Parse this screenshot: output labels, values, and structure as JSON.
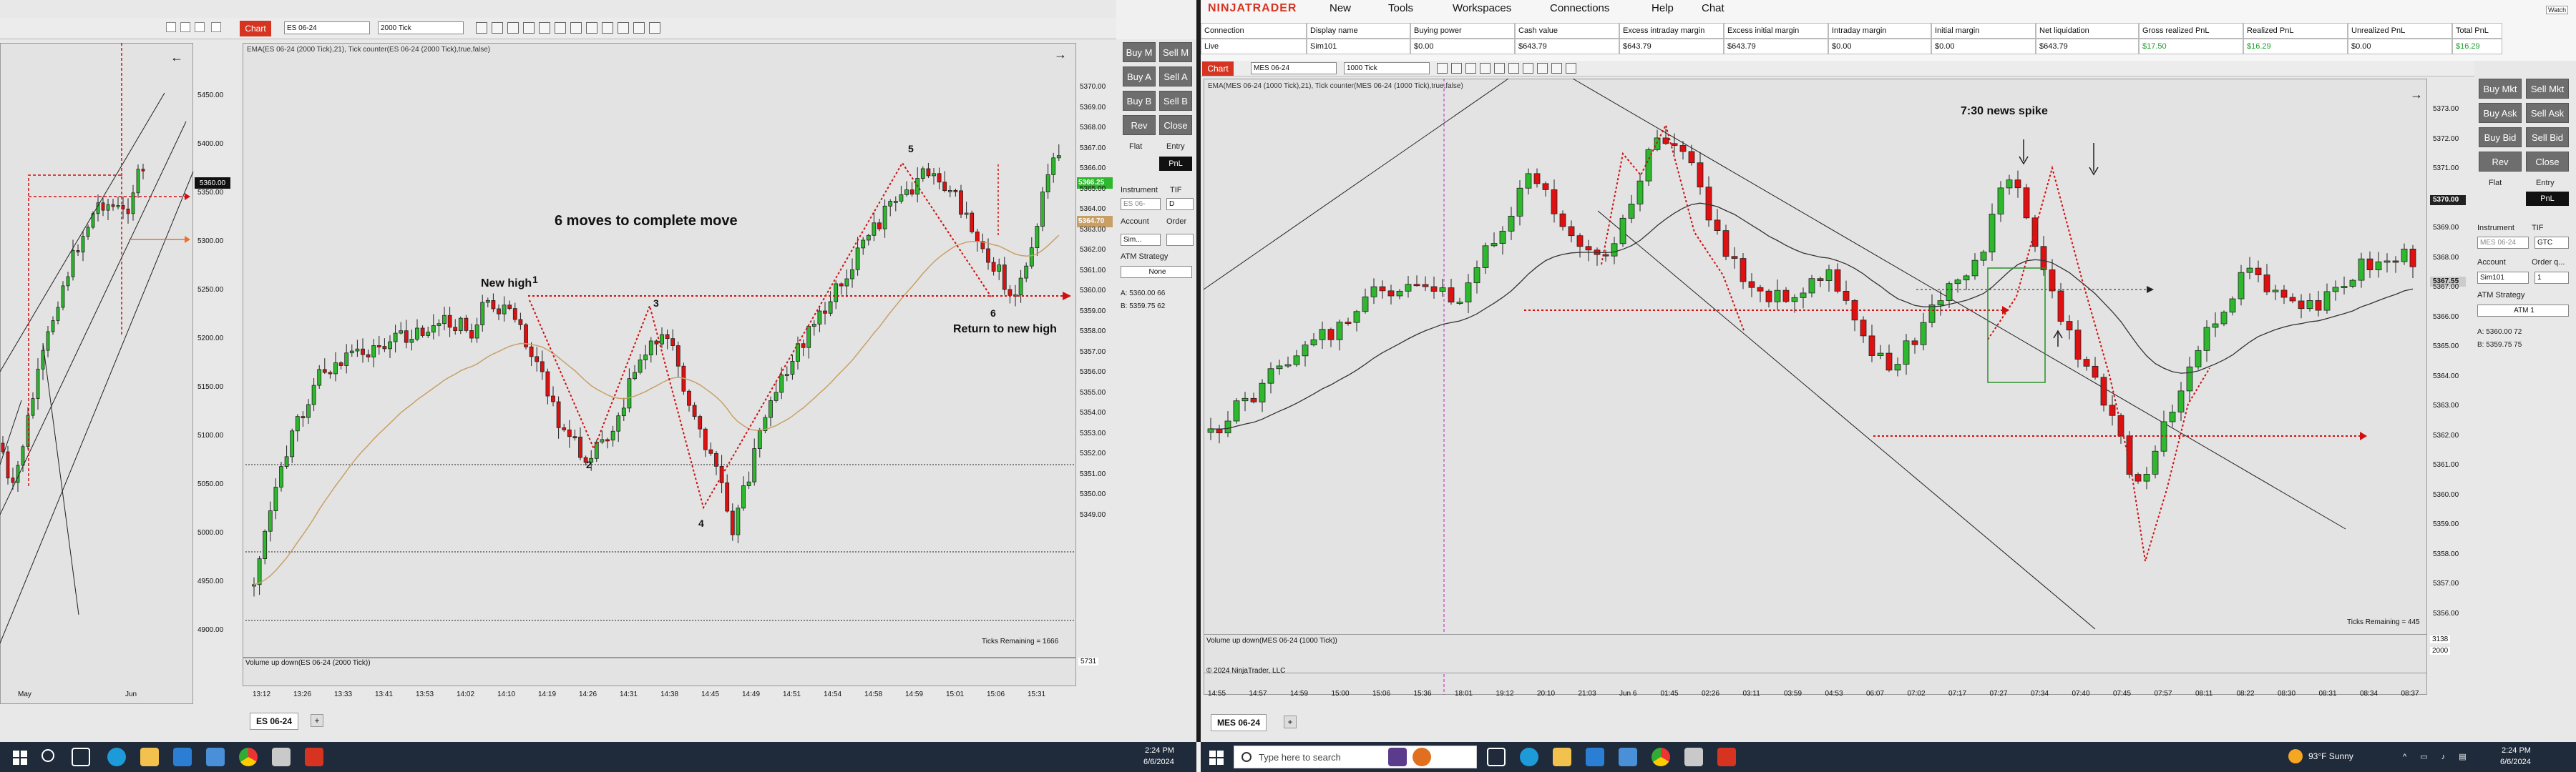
{
  "left_chart_small": {
    "price_labels": [
      "5450.00",
      "5400.00",
      "5350.00",
      "5300.00",
      "5250.00",
      "5200.00",
      "5150.00",
      "5100.00",
      "5050.00",
      "5000.00",
      "4950.00",
      "4900.00"
    ],
    "current_price": "5360.00",
    "time_labels": [
      "May",
      "Jun"
    ]
  },
  "left_chart": {
    "chart_tab_label": "Chart",
    "instrument_select": "ES 06-24",
    "interval_select": "2000 Tick",
    "indicator_header": "EMA(ES 06-24 (2000 Tick),21), Tick counter(ES 06-24 (2000 Tick),true,false)",
    "annotation_main": "6 moves to complete move",
    "annotation_new_high": "New high",
    "annotation_return": "Return to new high",
    "wave_labels": [
      "1",
      "2",
      "3",
      "4",
      "5",
      "6"
    ],
    "price_labels": [
      "5370.00",
      "5369.00",
      "5368.00",
      "5367.00",
      "5366.00",
      "5365.00",
      "5364.00",
      "5363.00",
      "5362.00",
      "5361.00",
      "5360.00",
      "5359.00",
      "5358.00",
      "5357.00",
      "5356.00",
      "5355.00",
      "5354.00",
      "5353.00",
      "5352.00",
      "5351.00",
      "5350.00",
      "5349.00"
    ],
    "current_price_tags": [
      "5366.25",
      "5364.70"
    ],
    "ticks_remaining": "Ticks Remaining = 1666",
    "volume_header": "Volume up down(ES 06-24 (2000 Tick))",
    "volume_scale": "5731",
    "time_labels": [
      "13:12",
      "13:26",
      "13:33",
      "13:41",
      "13:53",
      "14:02",
      "14:10",
      "14:19",
      "14:26",
      "14:31",
      "14:38",
      "14:45",
      "14:49",
      "14:51",
      "14:54",
      "14:58",
      "14:59",
      "15:01",
      "15:06",
      "15:31"
    ],
    "bottom_tab": "ES 06-24"
  },
  "left_order_panel": {
    "buy_mkt": "Buy M",
    "sell_mkt": "Sell M",
    "buy_ask": "Buy A",
    "sell_ask": "Sell A",
    "buy_bid": "Buy B",
    "sell_bid": "Sell B",
    "rev": "Rev",
    "close": "Close",
    "flat": "Flat",
    "entry": "Entry",
    "pnl": "PnL",
    "instrument_label": "Instrument",
    "tif_label": "TIF",
    "instrument_value": "ES 06-",
    "tif_value": "D",
    "account_label": "Account",
    "order_label": "Order",
    "account_value": "Sim...",
    "atm_label": "ATM Strategy",
    "atm_value": "None",
    "ask_line": "A:  5360.00   66",
    "bid_line": "B:  5359.75   62"
  },
  "nt_window": {
    "brand": "NINJATRADER",
    "menu": [
      "New",
      "Tools",
      "Workspaces",
      "Connections",
      "Help",
      "Chat"
    ],
    "account_columns": [
      "Connection",
      "Display name",
      "Buying power",
      "Cash value",
      "Excess intraday margin",
      "Excess initial margin",
      "Intraday margin",
      "Initial margin",
      "Net liquidation",
      "Gross realized PnL",
      "Realized PnL",
      "Unrealized PnL",
      "Total PnL"
    ],
    "account_row": [
      "Live",
      "Sim101",
      "$0.00",
      "$643.79",
      "$643.79",
      "$643.79",
      "$0.00",
      "$0.00",
      "$643.79",
      "$17.50",
      "$16.29",
      "$0.00",
      "$16.29"
    ],
    "positive_color": "#1a9e2a"
  },
  "right_chart": {
    "chart_tab_label": "Chart",
    "instrument_select": "MES 06-24",
    "interval_select": "1000 Tick",
    "indicator_header": "EMA(MES 06-24 (1000 Tick),21), Tick counter(MES 06-24 (1000 Tick),true,false)",
    "annotation_news": "7:30 news spike",
    "price_labels": [
      "5373.00",
      "5372.00",
      "5371.00",
      "5370.00",
      "5369.00",
      "5368.00",
      "5367.00",
      "5366.00",
      "5365.00",
      "5364.00",
      "5363.00",
      "5362.00",
      "5361.00",
      "5360.00",
      "5359.00",
      "5358.00",
      "5357.00",
      "5356.00"
    ],
    "current_price_tags": [
      "5370.00",
      "5367.55"
    ],
    "ticks_remaining": "Ticks Remaining = 445",
    "volume_header": "Volume up down(MES 06-24 (1000 Tick))",
    "copyright": "© 2024 NinjaTrader, LLC",
    "volume_scale": [
      "3138",
      "2000"
    ],
    "time_labels": [
      "14:55",
      "14:57",
      "14:59",
      "15:00",
      "15:06",
      "15:36",
      "18:01",
      "19:12",
      "20:10",
      "21:03",
      "Jun 6",
      "01:45",
      "02:26",
      "03:11",
      "03:59",
      "04:53",
      "06:07",
      "07:02",
      "07:17",
      "07:27",
      "07:34",
      "07:40",
      "07:45",
      "07:57",
      "08:11",
      "08:22",
      "08:30",
      "08:31",
      "08:34",
      "08:37"
    ],
    "bottom_tab": "MES 06-24"
  },
  "right_order_panel": {
    "buy_mkt": "Buy Mkt",
    "sell_mkt": "Sell Mkt",
    "buy_ask": "Buy Ask",
    "sell_ask": "Sell Ask",
    "buy_bid": "Buy Bid",
    "sell_bid": "Sell Bid",
    "rev": "Rev",
    "close": "Close",
    "flat": "Flat",
    "entry": "Entry",
    "pnl": "PnL",
    "instrument_label": "Instrument",
    "tif_label": "TIF",
    "instrument_value": "MES 06-24",
    "tif_value": "GTC",
    "account_label": "Account",
    "order_label": "Order q...",
    "account_value": "Sim101",
    "qty_value": "1",
    "atm_label": "ATM Strategy",
    "atm_value": "ATM 1",
    "ask_line": "A:  5360.00   72",
    "bid_line": "B:  5359.75   75",
    "watch_label": "Watch"
  },
  "taskbar_left": {
    "time": "2:24 PM",
    "date": "6/6/2024"
  },
  "taskbar_right": {
    "search_placeholder": "Type here to search",
    "weather": "93°F  Sunny",
    "time": "2:24 PM",
    "date": "6/6/2024"
  }
}
